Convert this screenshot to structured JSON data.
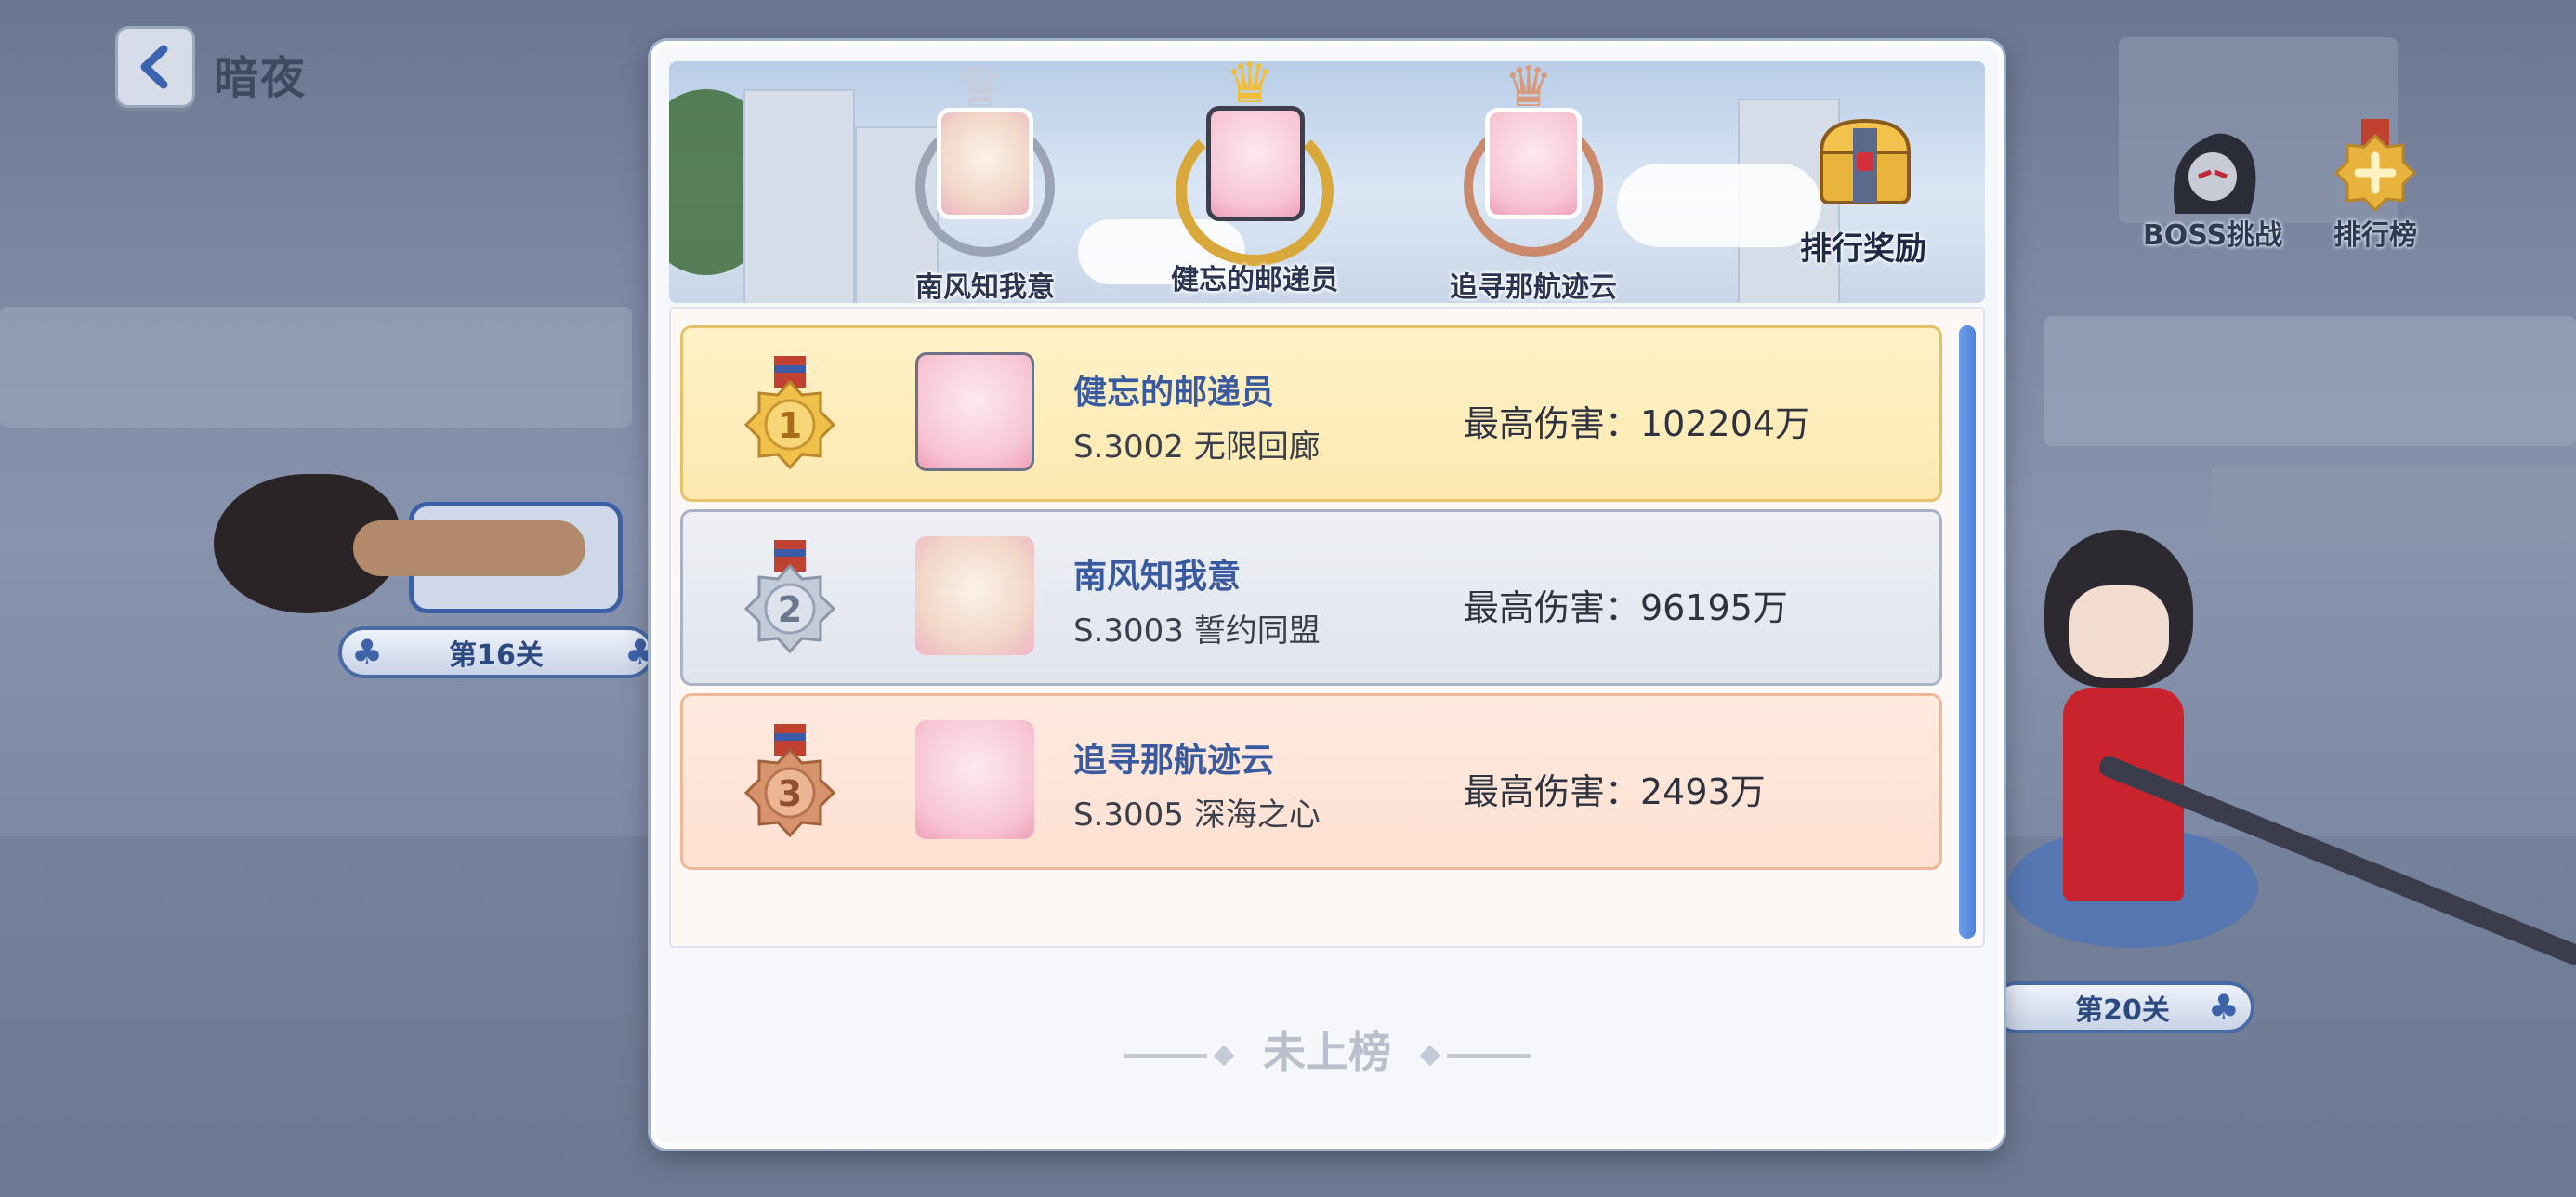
{
  "header": {
    "stage_name": "暗夜"
  },
  "side_buttons": {
    "boss_label": "BOSS挑战",
    "rank_label": "排行榜"
  },
  "stages": {
    "left": "第16关",
    "right": "第20关"
  },
  "podium": {
    "first_name": "健忘的邮递员",
    "second_name": "南风知我意",
    "third_name": "追寻那航迹云",
    "reward_label": "排行奖励"
  },
  "ranking": [
    {
      "rank": "1",
      "name": "健忘的邮递员",
      "server": "S.3002 无限回廊",
      "damage": "最高伤害：102204万"
    },
    {
      "rank": "2",
      "name": "南风知我意",
      "server": "S.3003 誓约同盟",
      "damage": "最高伤害：96195万"
    },
    {
      "rank": "3",
      "name": "追寻那航迹云",
      "server": "S.3005 深海之心",
      "damage": "最高伤害：2493万"
    }
  ],
  "self_status": "未上榜",
  "colors": {
    "gold": "#e8b53a",
    "silver": "#a9b4c8",
    "bronze": "#d0895d",
    "name_blue": "#3a5aa0",
    "scroll_blue": "#4f82d8"
  },
  "icons": {
    "back": "chevron-left-icon",
    "reward": "treasure-chest-icon",
    "boss": "boss-icon",
    "rank": "medal-icon"
  }
}
